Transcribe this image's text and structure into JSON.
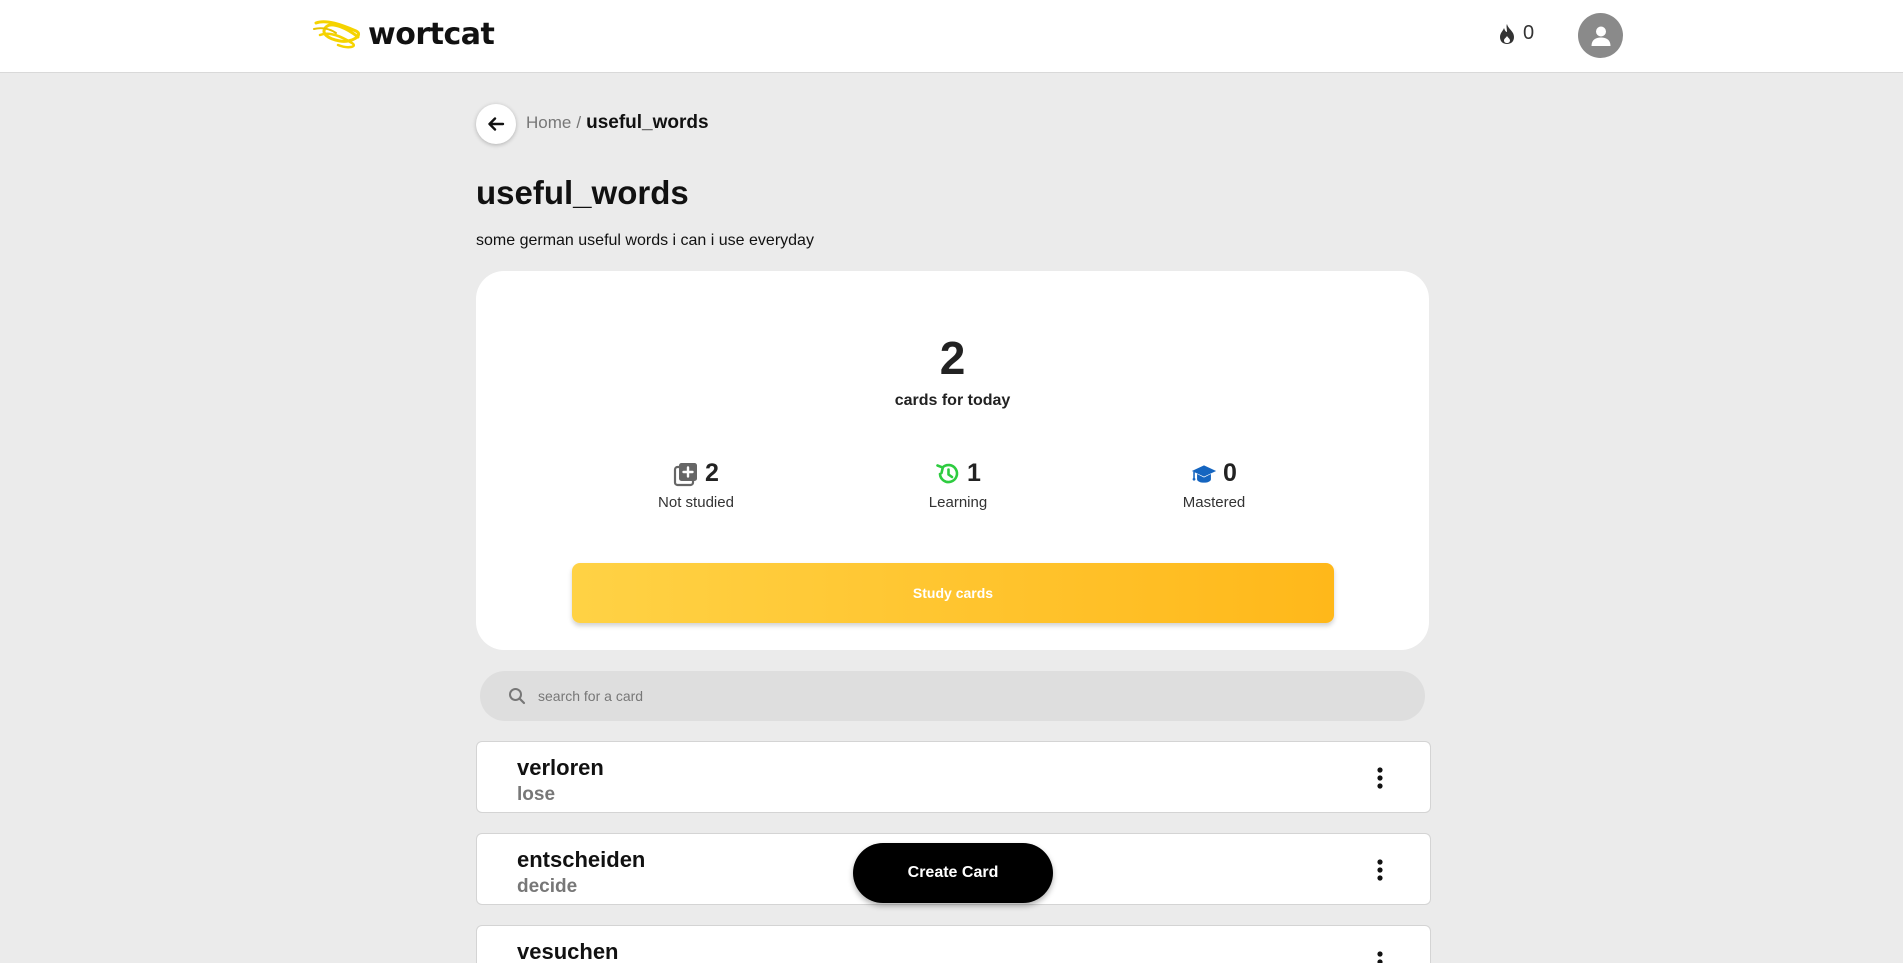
{
  "app": {
    "name": "wortcat"
  },
  "header": {
    "streak_count": "0"
  },
  "breadcrumb": {
    "home": "Home",
    "separator": "/",
    "current": "useful_words"
  },
  "deck": {
    "title": "useful_words",
    "description": "some german useful words i can i use everyday"
  },
  "stats": {
    "today_count": "2",
    "today_label": "cards for today",
    "not_studied": {
      "value": "2",
      "label": "Not studied"
    },
    "learning": {
      "value": "1",
      "label": "Learning"
    },
    "mastered": {
      "value": "0",
      "label": "Mastered"
    },
    "study_button": "Study cards"
  },
  "search": {
    "placeholder": "search for a card",
    "value": ""
  },
  "cards": [
    {
      "front": "verloren",
      "back": "lose"
    },
    {
      "front": "entscheiden",
      "back": "decide"
    },
    {
      "front": "vesuchen",
      "back": ""
    }
  ],
  "create_button": "Create Card",
  "colors": {
    "accent_start": "#ffd245",
    "accent_end": "#ffb81a",
    "learning_icon": "#2ecc40",
    "mastered_icon": "#1565c0",
    "not_studied_icon": "#666666"
  },
  "icons": {
    "logo": "yellow-scribble-logo",
    "streak": "flame-icon",
    "avatar": "user-icon",
    "back": "arrow-left-icon",
    "not_studied": "add-stack-icon",
    "learning": "history-icon",
    "mastered": "graduation-cap-icon",
    "search": "search-icon",
    "card_menu": "kebab-menu-icon"
  }
}
